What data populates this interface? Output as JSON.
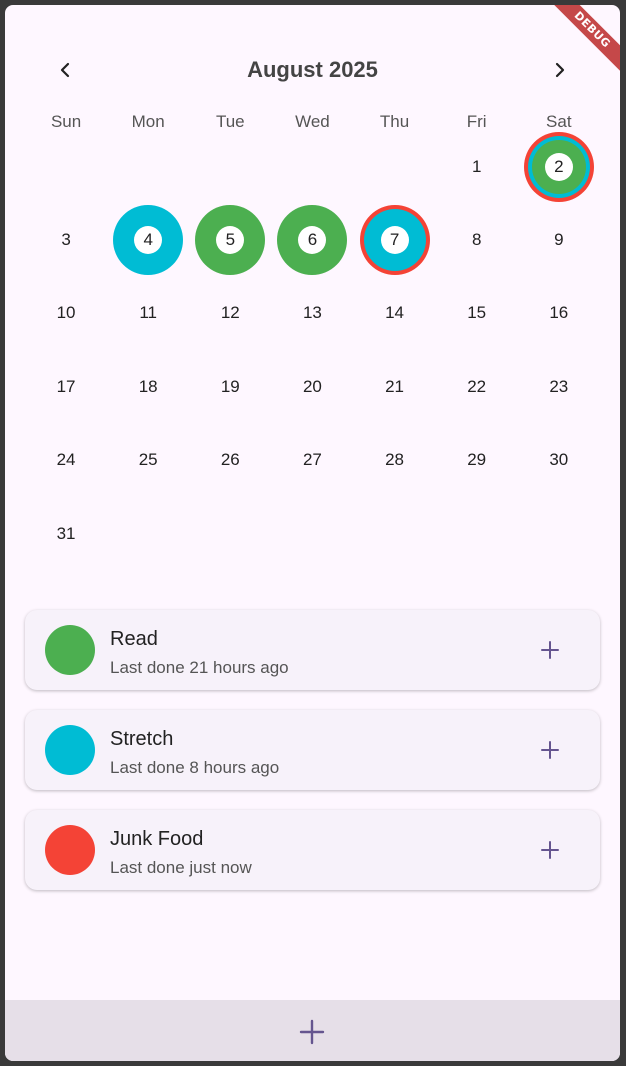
{
  "banner": {
    "label": "DEBUG"
  },
  "calendar": {
    "title": "August 2025",
    "prev_icon": "chevron-left-icon",
    "next_icon": "chevron-right-icon",
    "weekdays": [
      "Sun",
      "Mon",
      "Tue",
      "Wed",
      "Thu",
      "Fri",
      "Sat"
    ],
    "weeks": [
      [
        "",
        "",
        "",
        "",
        "",
        "1",
        "2"
      ],
      [
        "3",
        "4",
        "5",
        "6",
        "7",
        "8",
        "9"
      ],
      [
        "10",
        "11",
        "12",
        "13",
        "14",
        "15",
        "16"
      ],
      [
        "17",
        "18",
        "19",
        "20",
        "21",
        "22",
        "23"
      ],
      [
        "24",
        "25",
        "26",
        "27",
        "28",
        "29",
        "30"
      ],
      [
        "31",
        "",
        "",
        "",
        "",
        "",
        ""
      ]
    ],
    "marks": {
      "2": [
        "#f44336",
        "#00bcd4",
        "#4caf50"
      ],
      "4": [
        "#00bcd4"
      ],
      "5": [
        "#4caf50"
      ],
      "6": [
        "#4caf50"
      ],
      "7": [
        "#f44336",
        "#00bcd4"
      ]
    }
  },
  "habits": [
    {
      "name": "Read",
      "subtitle": "Last done 21 hours ago",
      "color": "#4caf50"
    },
    {
      "name": "Stretch",
      "subtitle": "Last done 8 hours ago",
      "color": "#00bcd4"
    },
    {
      "name": "Junk Food",
      "subtitle": "Last done just now",
      "color": "#f44336"
    }
  ],
  "icons": {
    "add": "plus-icon"
  },
  "colors": {
    "accent": "#65558f"
  }
}
